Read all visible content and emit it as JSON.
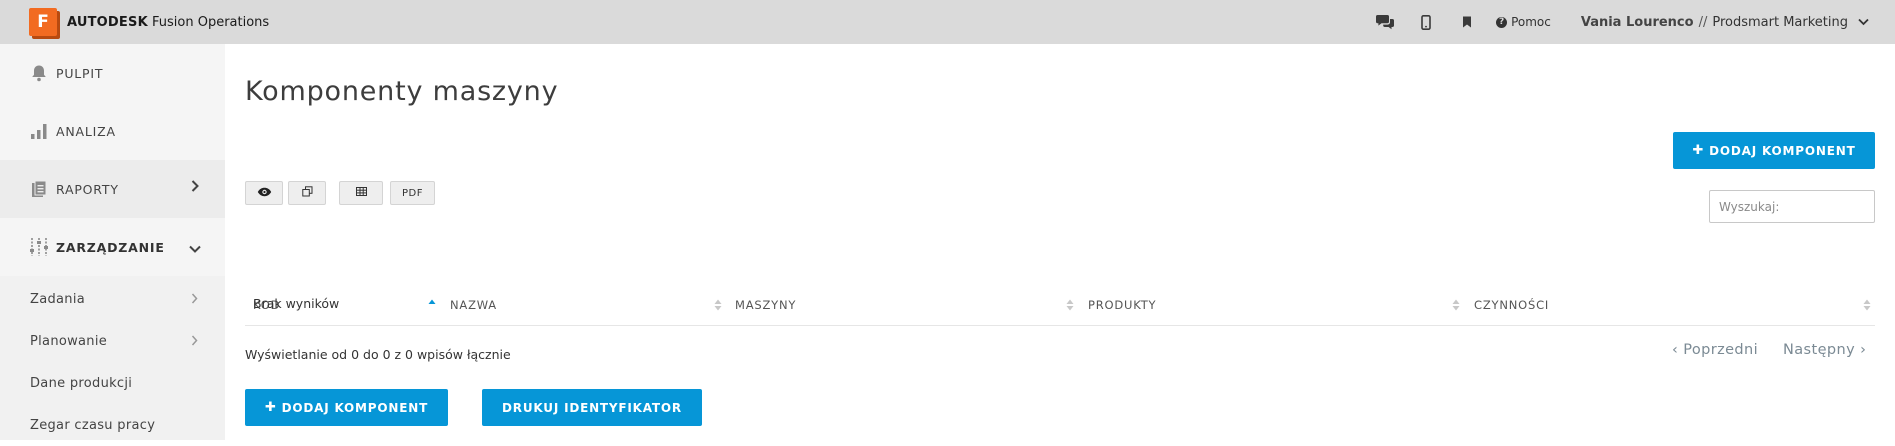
{
  "brand": {
    "logo_letter": "F",
    "company": "AUTODESK",
    "product": "Fusion Operations",
    "accent": "#f26b21"
  },
  "topbar": {
    "icons": [
      "chat-icon",
      "mobile-icon",
      "bookmark-icon"
    ],
    "help_label": "Pomoc",
    "user_name": "Vania Lourenco",
    "separator": "//",
    "company": "Prodsmart Marketing"
  },
  "sidebar": {
    "main_items": [
      {
        "label": "PULPIT",
        "icon": "bell-icon"
      },
      {
        "label": "ANALIZA",
        "icon": "bar-chart-icon"
      },
      {
        "label": "RAPORTY",
        "icon": "report-icon"
      },
      {
        "label": "ZARZĄDZANIE",
        "icon": "sliders-icon"
      }
    ],
    "sub_items": [
      {
        "label": "Zadania"
      },
      {
        "label": "Planowanie"
      },
      {
        "label": "Dane produkcji"
      },
      {
        "label": "Zegar czasu pracy"
      }
    ]
  },
  "main": {
    "title": "Komponenty maszyny",
    "add_button": "DODAJ KOMPONENT",
    "print_button": "DRUKUJ IDENTYFIKATOR",
    "toolbar": {
      "pdf_label": "PDF"
    },
    "search_placeholder": "Wyszukaj:",
    "columns": [
      "KOD",
      "NAZWA",
      "MASZYNY",
      "PRODUKTY",
      "CZYNNOŚCI"
    ],
    "empty_text": "Brak wyników",
    "info_text": "Wyświetlanie od 0 do 0 z 0 wpisów łącznie",
    "prev_label": "Poprzedni",
    "next_label": "Następny"
  },
  "colors": {
    "primary": "#0696d7",
    "topbar": "#dadada",
    "sidebar": "#f1f1f1"
  }
}
